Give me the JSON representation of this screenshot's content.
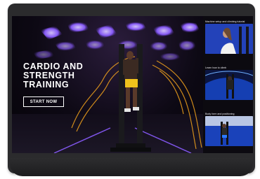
{
  "hero": {
    "title_line1": "CARDIO AND",
    "title_line2": "STRENGTH",
    "title_line3": "TRAINING",
    "cta_label": "START NOW"
  },
  "sidebar": {
    "videos": [
      {
        "label": "Machine setup and climbing tutorial"
      },
      {
        "label": "Learn how to climb"
      },
      {
        "label": "Body form and positioning"
      }
    ]
  },
  "colors": {
    "accent_orange": "#f0a11c",
    "neon_purple": "#8a5cff",
    "stage_blue": "#1d5cff"
  }
}
